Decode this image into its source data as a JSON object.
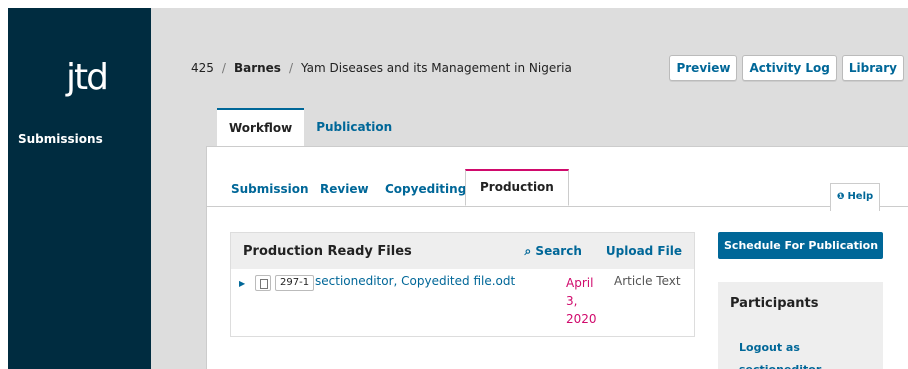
{
  "app": {
    "logo": "jtd"
  },
  "sidebar": {
    "items": [
      {
        "label": "Submissions"
      }
    ]
  },
  "breadcrumb": {
    "id": "425",
    "author": "Barnes",
    "title": "Yam Diseases and its Management in Nigeria"
  },
  "header_buttons": {
    "preview": "Preview",
    "activity_log": "Activity Log",
    "library": "Library"
  },
  "top_tabs": [
    {
      "label": "Workflow",
      "active": true
    },
    {
      "label": "Publication",
      "active": false
    }
  ],
  "stage_tabs": [
    {
      "label": "Submission",
      "active": false
    },
    {
      "label": "Review",
      "active": false
    },
    {
      "label": "Copyediting",
      "active": false
    },
    {
      "label": "Production",
      "active": true
    }
  ],
  "help": {
    "label": "Help",
    "icon": "info-circle-icon"
  },
  "files": {
    "title": "Production Ready Files",
    "search_label": "Search",
    "upload_label": "Upload File",
    "rows": [
      {
        "id": "297-1",
        "name": "sectioneditor, Copyedited file.odt",
        "date": "April 3, 2020",
        "type": "Article Text"
      }
    ]
  },
  "actions": {
    "schedule": "Schedule For Publication"
  },
  "participants": {
    "title": "Participants",
    "logout": "Logout as sectioneditor"
  },
  "colors": {
    "sidebar": "#002c40",
    "accent": "#006798",
    "highlight": "#d00a6c"
  }
}
